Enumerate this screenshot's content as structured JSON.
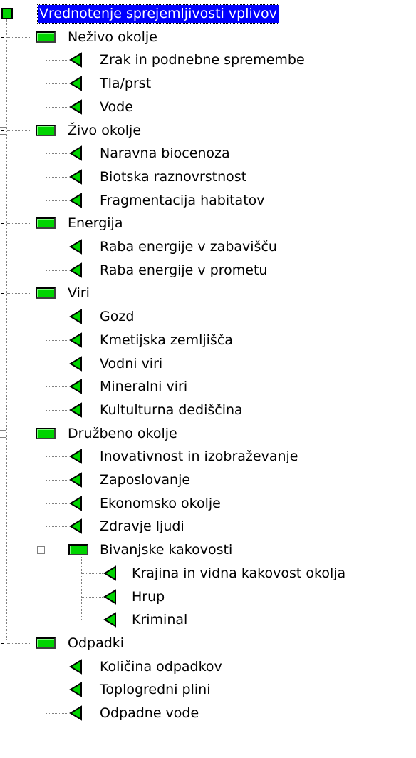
{
  "tree": {
    "root": {
      "label": "Vrednotenje sprejemljivosti vplivov",
      "selected": true,
      "icon": "green-square-icon"
    },
    "categories": [
      {
        "label": "Neživo okolje",
        "icon": "green-bar-icon",
        "expanded": true,
        "children": [
          {
            "label": "Zrak in podnebne spremembe",
            "icon": "green-triangle-icon"
          },
          {
            "label": "Tla/prst",
            "icon": "green-triangle-icon"
          },
          {
            "label": "Vode",
            "icon": "green-triangle-icon"
          }
        ]
      },
      {
        "label": "Živo okolje",
        "icon": "green-bar-icon",
        "expanded": true,
        "children": [
          {
            "label": "Naravna biocenoza",
            "icon": "green-triangle-icon"
          },
          {
            "label": "Biotska raznovrstnost",
            "icon": "green-triangle-icon"
          },
          {
            "label": "Fragmentacija habitatov",
            "icon": "green-triangle-icon"
          }
        ]
      },
      {
        "label": "Energija",
        "icon": "green-bar-icon",
        "expanded": true,
        "children": [
          {
            "label": "Raba energije v zabavišču",
            "icon": "green-triangle-icon"
          },
          {
            "label": "Raba energije v prometu",
            "icon": "green-triangle-icon"
          }
        ]
      },
      {
        "label": "Viri",
        "icon": "green-bar-icon",
        "expanded": true,
        "children": [
          {
            "label": "Gozd",
            "icon": "green-triangle-icon"
          },
          {
            "label": "Kmetijska zemljišča",
            "icon": "green-triangle-icon"
          },
          {
            "label": "Vodni viri",
            "icon": "green-triangle-icon"
          },
          {
            "label": "Mineralni viri",
            "icon": "green-triangle-icon"
          },
          {
            "label": "Kultulturna dediščina",
            "icon": "green-triangle-icon"
          }
        ]
      },
      {
        "label": "Družbeno okolje",
        "icon": "green-bar-icon",
        "expanded": true,
        "children": [
          {
            "label": "Inovativnost in izobraževanje",
            "icon": "green-triangle-icon"
          },
          {
            "label": "Zaposlovanje",
            "icon": "green-triangle-icon"
          },
          {
            "label": "Ekonomsko okolje",
            "icon": "green-triangle-icon"
          },
          {
            "label": "Zdravje ljudi",
            "icon": "green-triangle-icon"
          },
          {
            "label": "Bivanjske kakovosti",
            "icon": "green-bar-icon",
            "expanded": true,
            "children": [
              {
                "label": "Krajina in vidna kakovost okolja",
                "icon": "green-triangle-icon"
              },
              {
                "label": "Hrup",
                "icon": "green-triangle-icon"
              },
              {
                "label": "Kriminal",
                "icon": "green-triangle-icon"
              }
            ]
          }
        ]
      },
      {
        "label": "Odpadki",
        "icon": "green-bar-icon",
        "expanded": true,
        "children": [
          {
            "label": "Količina odpadkov",
            "icon": "green-triangle-icon"
          },
          {
            "label": "Toplogredni plini",
            "icon": "green-triangle-icon"
          },
          {
            "label": "Odpadne vode",
            "icon": "green-triangle-icon"
          }
        ]
      }
    ]
  },
  "colors": {
    "icon_green": "#00d400",
    "selection_bg": "#0000ff",
    "selection_text": "#ffffff",
    "tree_lines": "#808080"
  }
}
